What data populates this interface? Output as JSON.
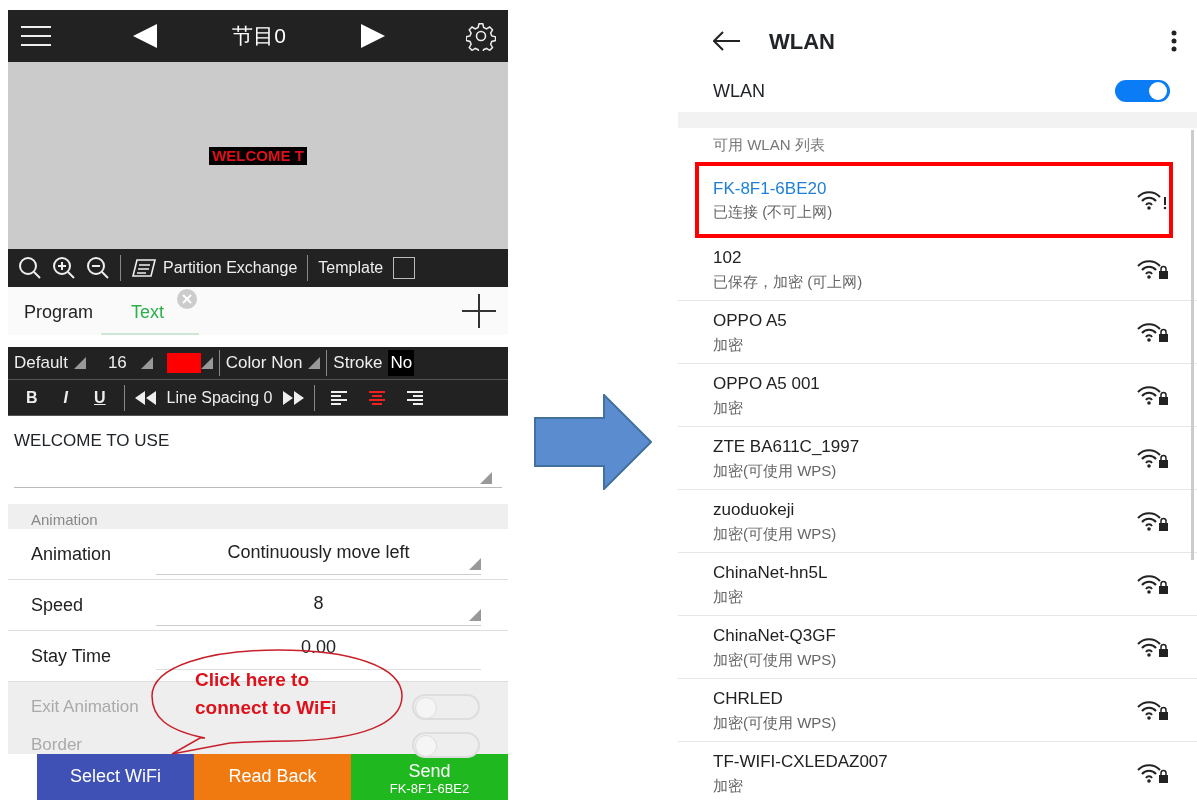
{
  "left_screen": {
    "header": {
      "title": "节目0"
    },
    "preview": {
      "text": "WELCOME T"
    },
    "toolbar": {
      "partition": "Partition Exchange",
      "template": "Template",
      "checkbox_checked": false
    },
    "tabs": [
      {
        "label": "Program",
        "selected": false
      },
      {
        "label": "Text",
        "selected": true
      }
    ],
    "format_bar": {
      "font": "Default",
      "size": "16",
      "text_color": {
        "color": "#ff0000"
      },
      "background": "Color Non",
      "stroke_label": "Stroke",
      "stroke_value": "No"
    },
    "style_bar": {
      "styles": [
        {
          "kind": "bold",
          "label": "B"
        },
        {
          "kind": "italic",
          "label": "I"
        },
        {
          "kind": "underline",
          "label": "U"
        }
      ],
      "line_spacing": "Line Spacing 0",
      "alignments": [
        {
          "kind": "left",
          "selected": false
        },
        {
          "kind": "center",
          "selected": true
        },
        {
          "kind": "right",
          "selected": false
        }
      ]
    },
    "text_field": {
      "value": "WELCOME TO USE"
    },
    "animation_section": {
      "title": "Animation",
      "rows": [
        {
          "label": "Animation",
          "value": "Continuously move left",
          "kind": "dropdown"
        },
        {
          "label": "Speed",
          "value": "8",
          "kind": "dropdown"
        },
        {
          "label": "Stay Time",
          "value": "0.00",
          "kind": "input"
        }
      ]
    },
    "toggles": [
      {
        "label": "Exit Animation",
        "on": false
      },
      {
        "label": "Border",
        "on": false
      }
    ],
    "buttons": [
      {
        "label": "Select WiFi",
        "color": "#3f51b5"
      },
      {
        "label": "Read Back",
        "color": "#f07a10"
      },
      {
        "label": "Send",
        "sublabel": "FK-8F1-6BE2",
        "color": "#1fb81f"
      }
    ],
    "callout": {
      "text": "Click here to connect to WiFi"
    }
  },
  "right_screen": {
    "header": {
      "title": "WLAN"
    },
    "wlan_switch": {
      "label": "WLAN",
      "on": true
    },
    "section_title": "可用 WLAN 列表",
    "networks": [
      {
        "name": "FK-8F1-6BE20",
        "status": "已连接 (不可上网)",
        "connected": true,
        "highlighted": true,
        "kind": "warning"
      },
      {
        "name": "102",
        "status": "已保存，加密 (可上网)",
        "connected": false,
        "highlighted": false,
        "kind": "locked"
      },
      {
        "name": "OPPO A5",
        "status": "加密",
        "connected": false,
        "highlighted": false,
        "kind": "locked"
      },
      {
        "name": "OPPO A5 001",
        "status": "加密",
        "connected": false,
        "highlighted": false,
        "kind": "locked"
      },
      {
        "name": "ZTE BA611C_1997",
        "status": "加密(可使用 WPS)",
        "connected": false,
        "highlighted": false,
        "kind": "locked"
      },
      {
        "name": "zuoduokeji",
        "status": "加密(可使用 WPS)",
        "connected": false,
        "highlighted": false,
        "kind": "locked"
      },
      {
        "name": "ChinaNet-hn5L",
        "status": "加密",
        "connected": false,
        "highlighted": false,
        "kind": "locked"
      },
      {
        "name": "ChinaNet-Q3GF",
        "status": "加密(可使用 WPS)",
        "connected": false,
        "highlighted": false,
        "kind": "locked"
      },
      {
        "name": "CHRLED",
        "status": "加密(可使用 WPS)",
        "connected": false,
        "highlighted": false,
        "kind": "locked"
      },
      {
        "name": "TF-WIFI-CXLEDAZ007",
        "status": "加密",
        "connected": false,
        "highlighted": false,
        "kind": "locked"
      }
    ]
  }
}
